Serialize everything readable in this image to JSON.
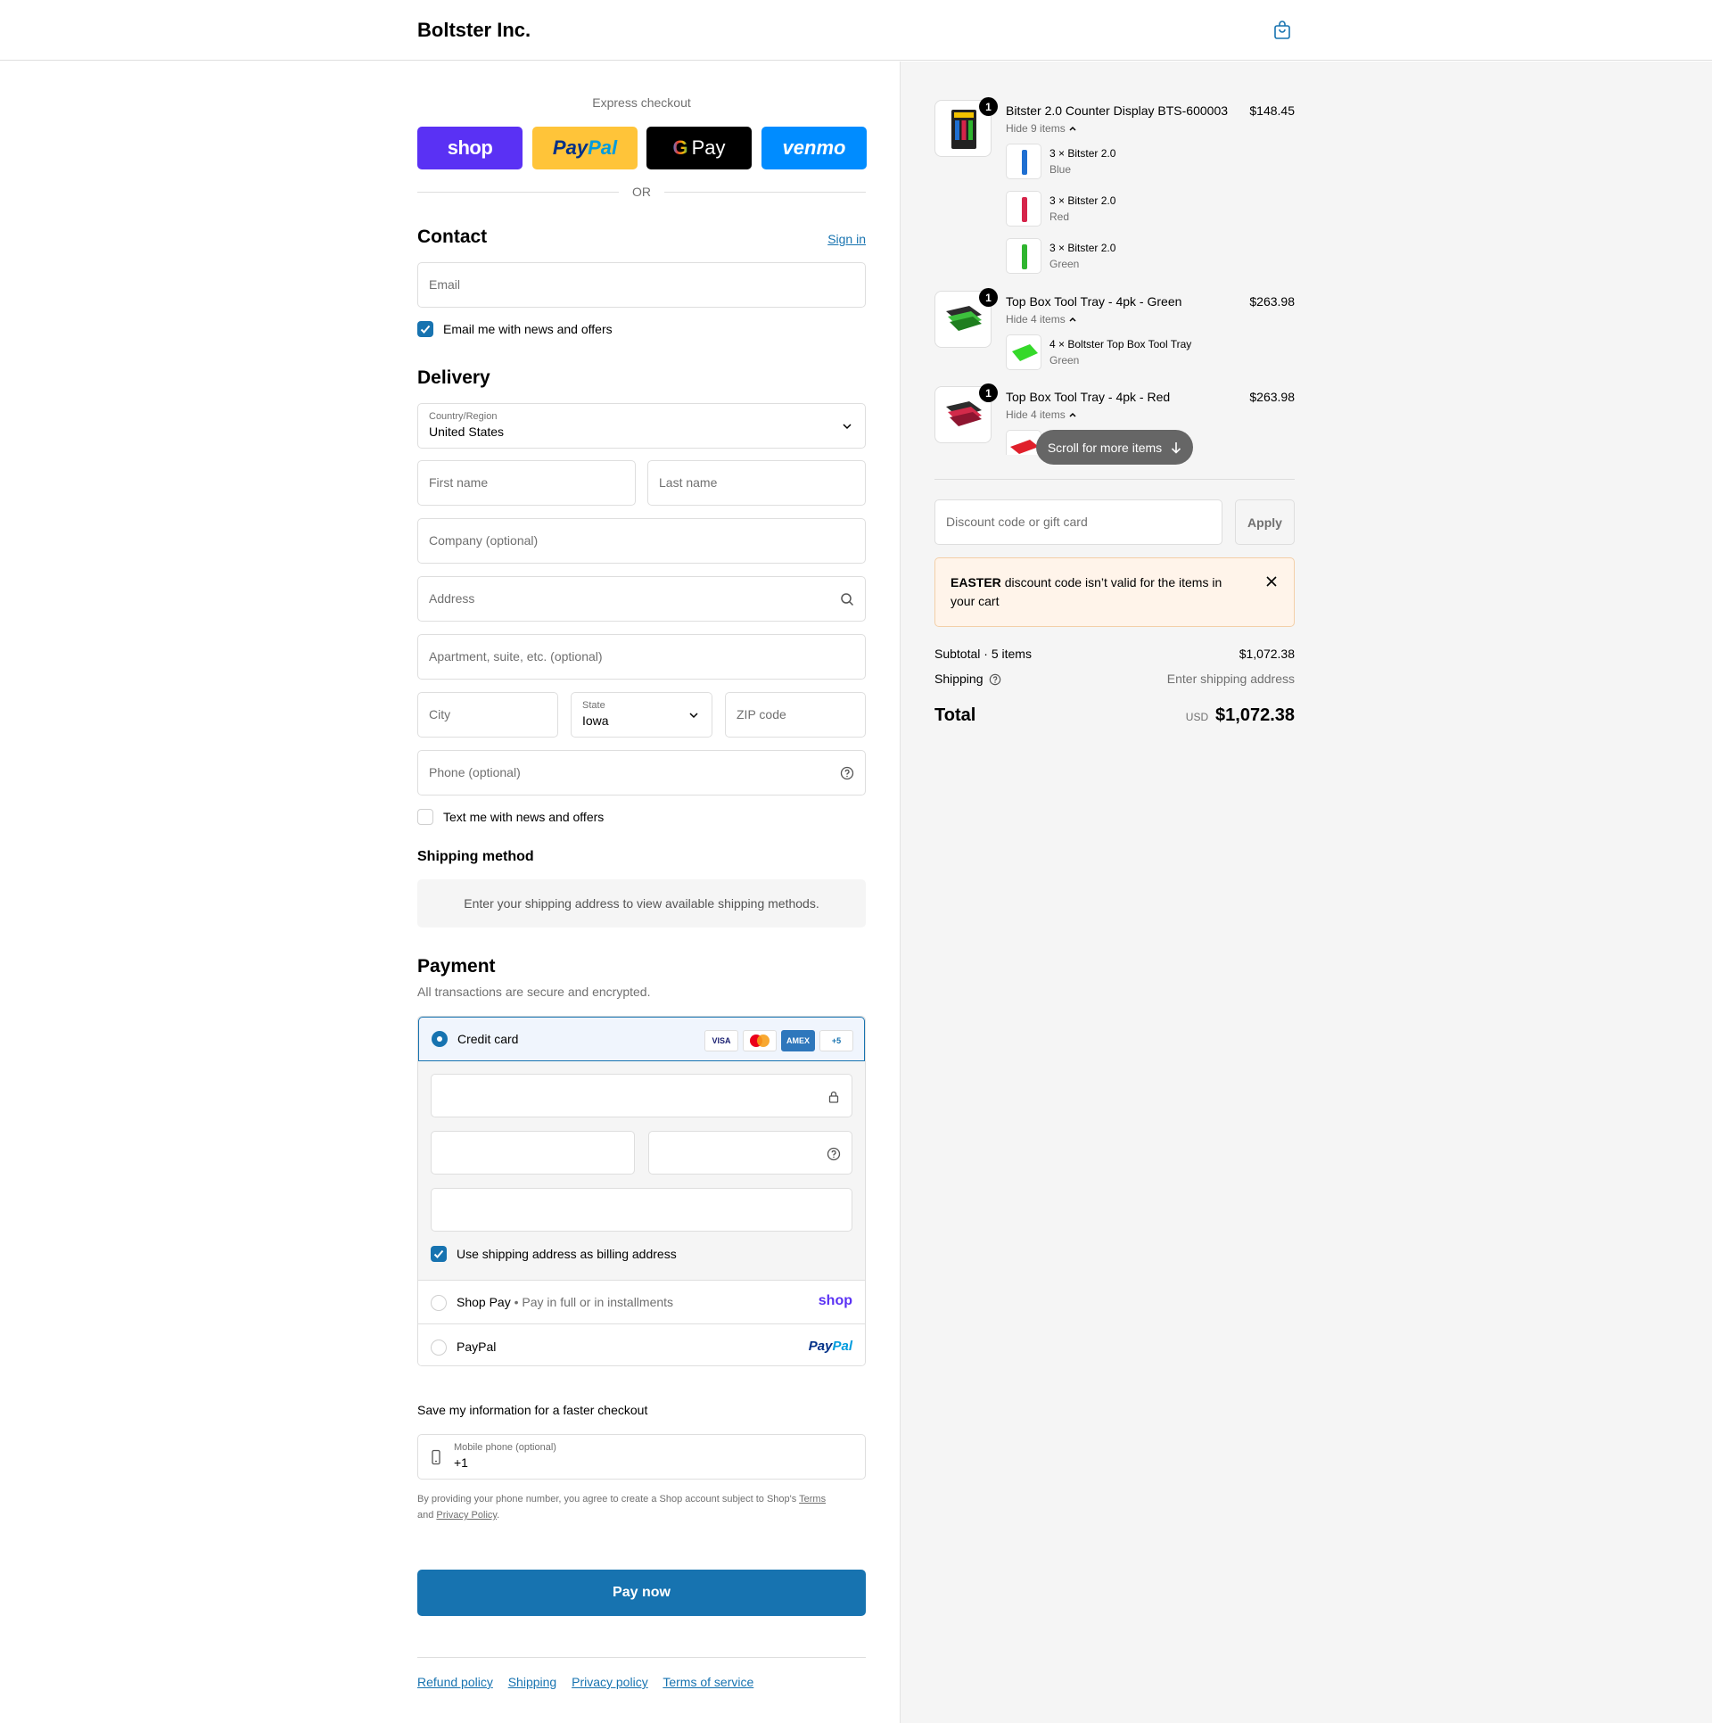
{
  "header": {
    "brand": "Boltster Inc.",
    "cart_icon": "shopping-bag-icon"
  },
  "express": {
    "title": "Express checkout",
    "shop_label": "shop",
    "paypal_label_1": "Pay",
    "paypal_label_2": "Pal",
    "gpay_g": "G",
    "gpay_label": "Pay",
    "venmo_label": "venmo",
    "or_label": "OR"
  },
  "contact": {
    "title": "Contact",
    "sign_in": "Sign in",
    "email_placeholder": "Email",
    "email_news_label": "Email me with news and offers",
    "email_news_checked": true
  },
  "delivery": {
    "title": "Delivery",
    "country_label": "Country/Region",
    "country_value": "United States",
    "first_name_placeholder": "First name",
    "last_name_placeholder": "Last name",
    "company_placeholder": "Company (optional)",
    "address_placeholder": "Address",
    "apartment_placeholder": "Apartment, suite, etc. (optional)",
    "city_placeholder": "City",
    "state_label": "State",
    "state_value": "Iowa",
    "zip_placeholder": "ZIP code",
    "phone_placeholder": "Phone (optional)",
    "text_news_label": "Text me with news and offers",
    "text_news_checked": false
  },
  "shipping_method": {
    "title": "Shipping method",
    "message": "Enter your shipping address to view available shipping methods."
  },
  "payment": {
    "title": "Payment",
    "subtitle": "All transactions are secure and encrypted.",
    "credit_card_label": "Credit card",
    "card_badges": [
      "VISA",
      "",
      "AMEX",
      "+5"
    ],
    "billing_same_label": "Use shipping address as billing address",
    "shop_pay_label": "Shop Pay",
    "shop_pay_sep": "•",
    "shop_pay_desc": "Pay in full or in installments",
    "shop_pay_logo": "shop",
    "paypal_label": "PayPal",
    "paypal_logo_1": "Pay",
    "paypal_logo_2": "Pal"
  },
  "save_info": {
    "title": "Save my information for a faster checkout",
    "mobile_label": "Mobile phone (optional)",
    "mobile_value": "+1",
    "legal_prefix": "By providing your phone number, you agree to create a Shop account subject to Shop's",
    "terms": "Terms",
    "and": "and",
    "privacy": "Privacy Policy",
    "period": "."
  },
  "pay_now": "Pay now",
  "footer": {
    "links": [
      "Refund policy",
      "Shipping",
      "Privacy policy",
      "Terms of service"
    ]
  },
  "cart": {
    "items": [
      {
        "name": "Bitster 2.0 Counter Display BTS-600003",
        "price": "$148.45",
        "qty": "1",
        "hide_label": "Hide 9 items",
        "sub_items": [
          {
            "qty_name": "3 × Bitster 2.0",
            "variant": "Blue",
            "color": "#1f6fd1"
          },
          {
            "qty_name": "3 × Bitster 2.0",
            "variant": "Red",
            "color": "#d6244a"
          },
          {
            "qty_name": "3 × Bitster 2.0",
            "variant": "Green",
            "color": "#2fb52f"
          }
        ]
      },
      {
        "name": "Top Box Tool Tray - 4pk - Green",
        "price": "$263.98",
        "qty": "1",
        "hide_label": "Hide 4 items",
        "sub_items": [
          {
            "qty_name": "4 × Boltster Top Box Tool Tray",
            "variant": "Green",
            "color": "#35d92a"
          }
        ]
      },
      {
        "name": "Top Box Tool Tray - 4pk - Red",
        "price": "$263.98",
        "qty": "1",
        "hide_label": "Hide 4 items"
      }
    ],
    "scroll_hint": "Scroll for more items",
    "discount_placeholder": "Discount code or gift card",
    "apply_label": "Apply",
    "error_code": "EASTER",
    "error_message": "discount code isn’t valid for the items in your cart",
    "subtotal_label": "Subtotal · 5 items",
    "subtotal_value": "$1,072.38",
    "shipping_label": "Shipping",
    "shipping_value": "Enter shipping address",
    "total_label": "Total",
    "currency": "USD",
    "total_value": "$1,072.38"
  },
  "colors": {
    "accent": "#1773b0",
    "shop_purple": "#5a31f4",
    "paypal_yellow": "#ffc439",
    "venmo_blue": "#008cff",
    "error_bg": "#fff4ea"
  }
}
